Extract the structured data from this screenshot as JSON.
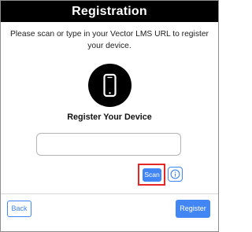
{
  "header": {
    "title": "Registration"
  },
  "instructions": {
    "text": "Please scan or type in your Vector LMS URL to register your device."
  },
  "device_icon": "smartphone-icon",
  "section_title": "Register Your Device",
  "url_input": {
    "value": "",
    "placeholder": ""
  },
  "actions": {
    "scan_label": "Scan",
    "info_icon": "info-icon"
  },
  "footer": {
    "back_label": "Back",
    "register_label": "Register"
  },
  "colors": {
    "header_bg": "#000000",
    "accent": "#4285f4",
    "highlight": "#e32626"
  }
}
